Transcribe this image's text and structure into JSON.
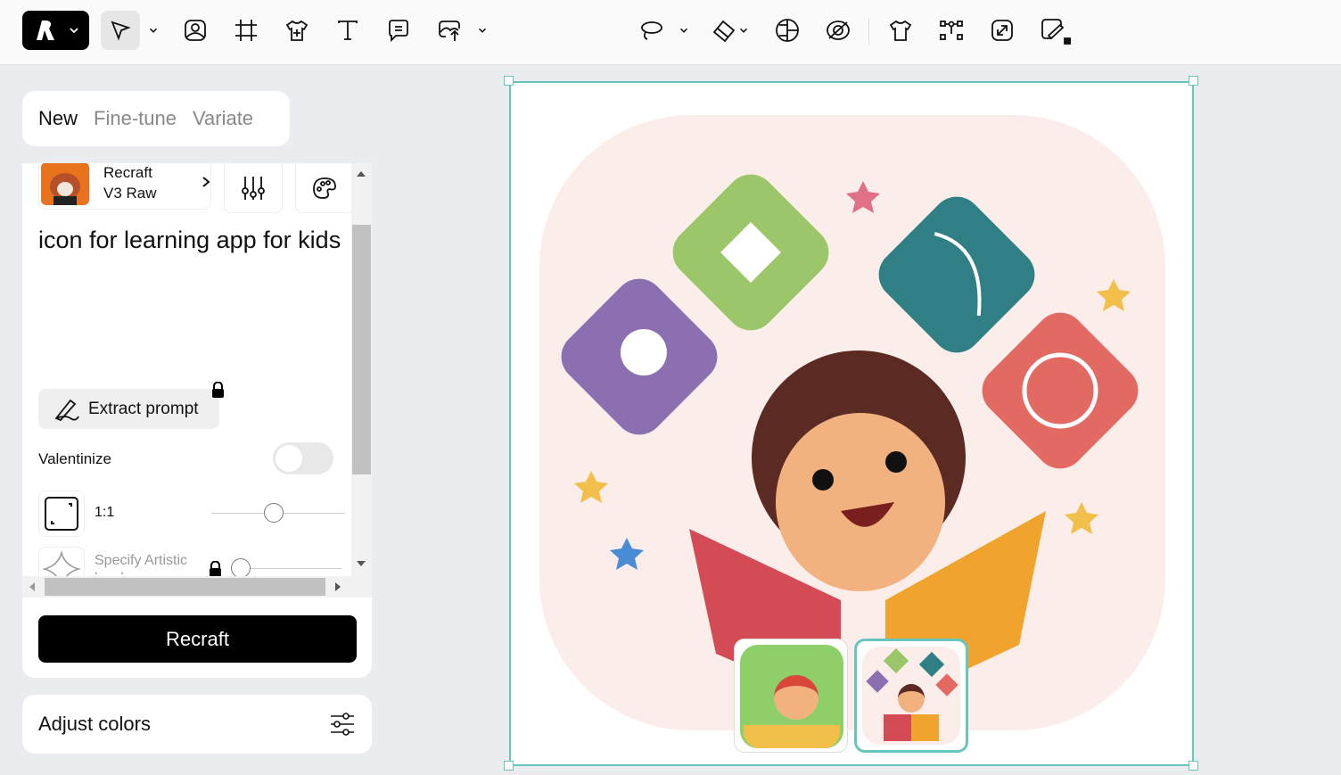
{
  "toolbar": {
    "tools": [
      "logo-menu",
      "select",
      "image",
      "frame",
      "mockup",
      "text",
      "comment",
      "upload-image",
      "lasso",
      "eraser",
      "vectorize",
      "remove-background",
      "mockup-shirt",
      "vector-nodes",
      "upscale",
      "edit-locked"
    ]
  },
  "tabs": {
    "items": [
      "New",
      "Fine-tune",
      "Variate"
    ],
    "active": "New"
  },
  "model": {
    "name_line1": "Recraft",
    "name_line2": "V3 Raw"
  },
  "prompt": {
    "value": "icon for learning app for kids"
  },
  "extract": {
    "label": "Extract prompt"
  },
  "valentinize": {
    "label": "Valentinize",
    "on": false
  },
  "aspect": {
    "label": "1:1",
    "slider": 0.5
  },
  "artistic": {
    "label": "Specify Artistic level",
    "slider": 0
  },
  "generate": {
    "label": "Recraft"
  },
  "adjust": {
    "label": "Adjust colors"
  },
  "colors": {
    "accent": "#66c6bb",
    "primary": "#000000"
  },
  "thumbnails": {
    "count": 2,
    "selected": 1
  }
}
